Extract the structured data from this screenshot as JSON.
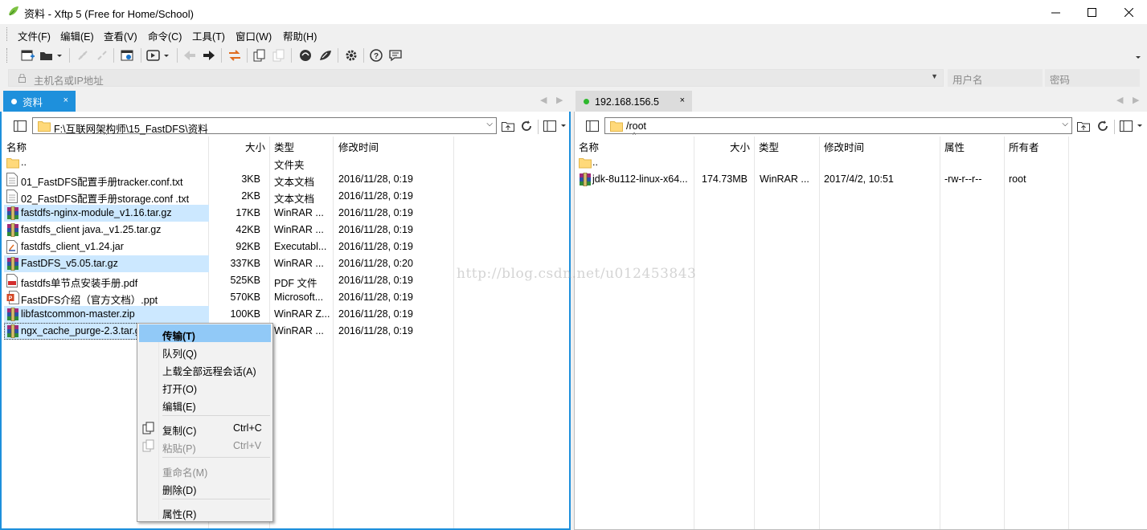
{
  "window": {
    "title": "资料 - Xftp 5 (Free for Home/School)",
    "accent": "#1e90dc",
    "controls": [
      "minimize-icon",
      "maximize-icon",
      "close-icon"
    ]
  },
  "menu": [
    "文件(F)",
    "编辑(E)",
    "查看(V)",
    "命令(C)",
    "工具(T)",
    "窗口(W)",
    "帮助(H)"
  ],
  "address": {
    "host_placeholder": "主机名或IP地址",
    "user_placeholder": "用户名",
    "password_placeholder": "密码"
  },
  "left": {
    "tab_label": "资料",
    "path": "F:\\互联网架构师\\15_FastDFS\\资料",
    "columns": [
      "名称",
      "大小",
      "类型",
      "修改时间"
    ],
    "files": [
      {
        "name": "..",
        "size": "",
        "type": "文件夹",
        "mtime": "",
        "icon": "folder-icon",
        "selected": false
      },
      {
        "name": "01_FastDFS配置手册tracker.conf.txt",
        "size": "3KB",
        "type": "文本文档",
        "mtime": "2016/11/28, 0:19",
        "icon": "text-file-icon",
        "selected": false
      },
      {
        "name": "02_FastDFS配置手册storage.conf .txt",
        "size": "2KB",
        "type": "文本文档",
        "mtime": "2016/11/28, 0:19",
        "icon": "text-file-icon",
        "selected": false
      },
      {
        "name": "fastdfs-nginx-module_v1.16.tar.gz",
        "size": "17KB",
        "type": "WinRAR ...",
        "mtime": "2016/11/28, 0:19",
        "icon": "winrar-icon",
        "selected": true
      },
      {
        "name": "fastdfs_client java._v1.25.tar.gz",
        "size": "42KB",
        "type": "WinRAR ...",
        "mtime": "2016/11/28, 0:19",
        "icon": "winrar-icon",
        "selected": false
      },
      {
        "name": "fastdfs_client_v1.24.jar",
        "size": "92KB",
        "type": "Executabl...",
        "mtime": "2016/11/28, 0:19",
        "icon": "java-jar-icon",
        "selected": false
      },
      {
        "name": "FastDFS_v5.05.tar.gz",
        "size": "337KB",
        "type": "WinRAR ...",
        "mtime": "2016/11/28, 0:20",
        "icon": "winrar-icon",
        "selected": true
      },
      {
        "name": "fastdfs单节点安装手册.pdf",
        "size": "525KB",
        "type": "PDF 文件",
        "mtime": "2016/11/28, 0:19",
        "icon": "pdf-icon",
        "selected": false
      },
      {
        "name": "FastDFS介绍（官方文档）.ppt",
        "size": "570KB",
        "type": "Microsoft...",
        "mtime": "2016/11/28, 0:19",
        "icon": "ppt-icon",
        "selected": false
      },
      {
        "name": "libfastcommon-master.zip",
        "size": "100KB",
        "type": "WinRAR Z...",
        "mtime": "2016/11/28, 0:19",
        "icon": "winrar-icon",
        "selected": true
      },
      {
        "name": "ngx_cache_purge-2.3.tar.g",
        "size": "",
        "type": "WinRAR ...",
        "mtime": "2016/11/28, 0:19",
        "icon": "winrar-icon",
        "selected": true
      }
    ]
  },
  "right": {
    "tab_label": "192.168.156.5",
    "path": "/root",
    "columns": [
      "名称",
      "大小",
      "类型",
      "修改时间",
      "属性",
      "所有者"
    ],
    "files": [
      {
        "name": "..",
        "size": "",
        "type": "",
        "mtime": "",
        "attr": "",
        "owner": "",
        "icon": "folder-icon"
      },
      {
        "name": "jdk-8u112-linux-x64...",
        "size": "174.73MB",
        "type": "WinRAR ...",
        "mtime": "2017/4/2, 10:51",
        "attr": "-rw-r--r--",
        "owner": "root",
        "icon": "winrar-icon"
      }
    ]
  },
  "context_menu": {
    "items": [
      {
        "label": "传输(T)",
        "shortcut": "",
        "bold": true,
        "highlight": true,
        "disabled": false,
        "icon": ""
      },
      {
        "label": "队列(Q)",
        "shortcut": "",
        "bold": false,
        "highlight": false,
        "disabled": false,
        "icon": ""
      },
      {
        "label": "上载全部远程会话(A)",
        "shortcut": "",
        "bold": false,
        "highlight": false,
        "disabled": false,
        "icon": ""
      },
      {
        "label": "打开(O)",
        "shortcut": "",
        "bold": false,
        "highlight": false,
        "disabled": false,
        "icon": ""
      },
      {
        "label": "编辑(E)",
        "shortcut": "",
        "bold": false,
        "highlight": false,
        "disabled": false,
        "icon": ""
      },
      {
        "sep": true
      },
      {
        "label": "复制(C)",
        "shortcut": "Ctrl+C",
        "bold": false,
        "highlight": false,
        "disabled": false,
        "icon": "copy-icon"
      },
      {
        "label": "粘贴(P)",
        "shortcut": "Ctrl+V",
        "bold": false,
        "highlight": false,
        "disabled": true,
        "icon": "paste-icon"
      },
      {
        "sep": true
      },
      {
        "label": "重命名(M)",
        "shortcut": "",
        "bold": false,
        "highlight": false,
        "disabled": true,
        "icon": ""
      },
      {
        "label": "删除(D)",
        "shortcut": "",
        "bold": false,
        "highlight": false,
        "disabled": false,
        "icon": ""
      },
      {
        "sep": true
      },
      {
        "label": "属性(R)",
        "shortcut": "",
        "bold": false,
        "highlight": false,
        "disabled": false,
        "icon": ""
      }
    ]
  },
  "watermark": "http://blog.csdn.net/u012453843"
}
